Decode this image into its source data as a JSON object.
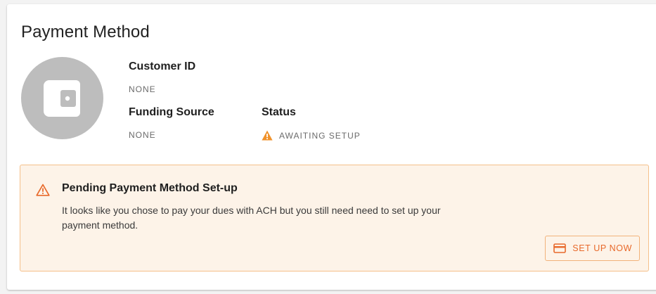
{
  "card": {
    "title": "Payment Method",
    "avatar_icon": "wallet-icon"
  },
  "fields": {
    "customer_id": {
      "label": "Customer ID",
      "value": "NONE"
    },
    "funding_source": {
      "label": "Funding Source",
      "value": "NONE"
    },
    "status": {
      "label": "Status",
      "value": "AWAITING SETUP",
      "icon": "warning-icon",
      "color": "#f0922b"
    }
  },
  "alert": {
    "icon": "warning-outline-icon",
    "title": "Pending Payment Method Set-up",
    "body": "It looks like you chose to pay your dues with ACH but you still need need to set up your payment method.",
    "background": "#fdf3e8",
    "border": "#f5c08a",
    "button": {
      "label": "SET UP NOW",
      "icon": "credit-card-icon",
      "color": "#e8692a"
    }
  }
}
